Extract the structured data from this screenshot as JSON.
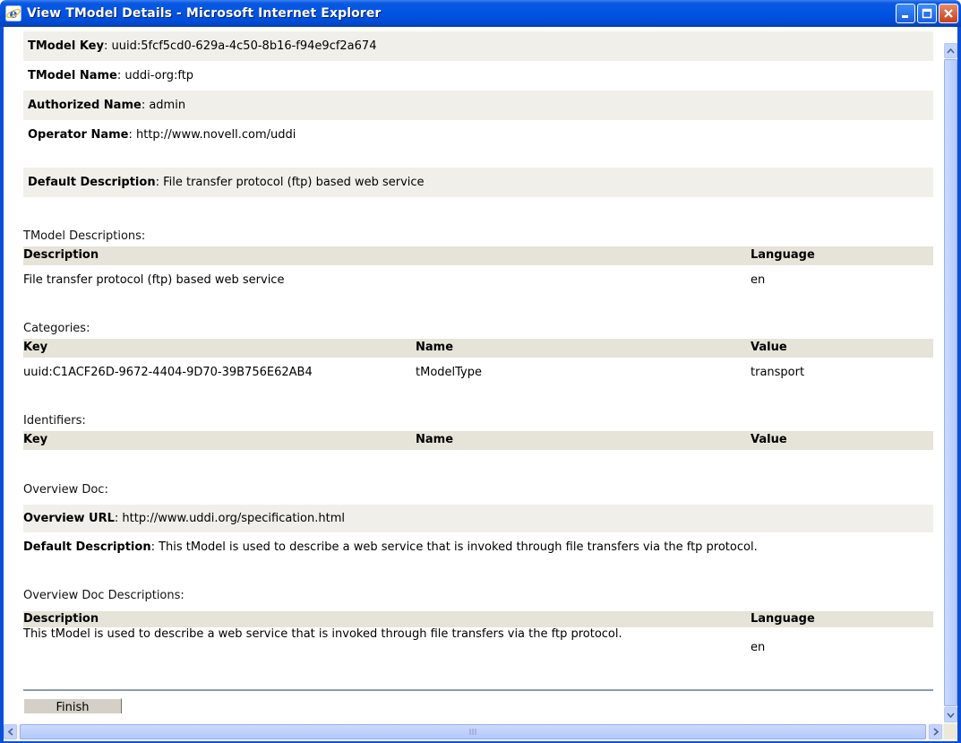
{
  "window": {
    "title": "View TModel Details - Microsoft Internet Explorer"
  },
  "details": {
    "tmodel_key_label": "TModel Key",
    "tmodel_key_value": ": uuid:5fcf5cd0-629a-4c50-8b16-f94e9cf2a674",
    "tmodel_name_label": "TModel Name",
    "tmodel_name_value": ": uddi-org:ftp",
    "authorized_name_label": "Authorized Name",
    "authorized_name_value": ": admin",
    "operator_name_label": "Operator Name",
    "operator_name_value": ": http://www.novell.com/uddi",
    "default_description_label": "Default Description",
    "default_description_value": ": File transfer protocol (ftp) based web service"
  },
  "tmodel_descriptions": {
    "section_label": "TModel Descriptions:",
    "headers": {
      "description": "Description",
      "language": "Language"
    },
    "rows": [
      {
        "description": "File transfer protocol (ftp) based web service",
        "language": "en"
      }
    ]
  },
  "categories": {
    "section_label": "Categories:",
    "headers": {
      "key": "Key",
      "name": "Name",
      "value": "Value"
    },
    "rows": [
      {
        "key": "uuid:C1ACF26D-9672-4404-9D70-39B756E62AB4",
        "name": "tModelType",
        "value": "transport"
      }
    ]
  },
  "identifiers": {
    "section_label": "Identifiers:",
    "headers": {
      "key": "Key",
      "name": "Name",
      "value": "Value"
    }
  },
  "overview_doc": {
    "section_label": "Overview Doc:",
    "url_label": "Overview URL",
    "url_value": ": http://www.uddi.org/specification.html",
    "default_description_label": "Default Description",
    "default_description_value": ": This tModel is used to describe a web service that is invoked through file transfers via the ftp protocol."
  },
  "overview_doc_descriptions": {
    "section_label": "Overview Doc Descriptions:",
    "headers": {
      "description": "Description",
      "language": "Language"
    },
    "rows": [
      {
        "description": "This tModel is used to describe a web service that is invoked through file transfers via the ftp protocol.",
        "language": "en"
      }
    ]
  },
  "buttons": {
    "finish_label": "Finish"
  },
  "icons": {
    "app": "ie-icon",
    "minimize": "minimize-icon",
    "maximize": "maximize-icon",
    "close": "close-icon"
  },
  "colors": {
    "titlebar": "#0054e3",
    "row_shade": "#f0efe9",
    "table_header": "#e6e3d9"
  }
}
